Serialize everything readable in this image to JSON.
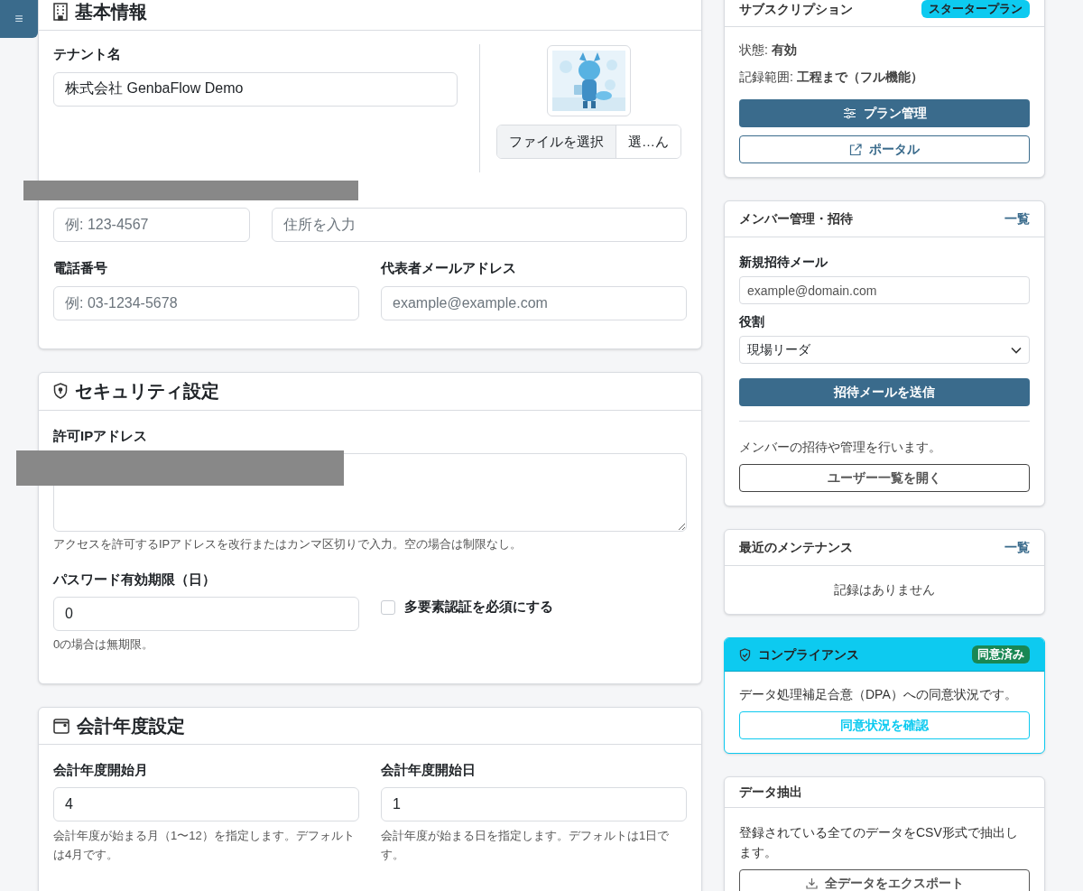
{
  "sidebar_toggle": {
    "label": "≡"
  },
  "basic_info": {
    "title": "基本情報",
    "tenant_name": {
      "label": "テナント名",
      "value": "株式会社 GenbaFlow Demo"
    },
    "file_button": "ファイルを選択",
    "file_name": "選…ん",
    "postal_code": {
      "placeholder": "例: 123-4567"
    },
    "address": {
      "placeholder": "住所を入力"
    },
    "phone": {
      "label": "電話番号",
      "placeholder": "例: 03-1234-5678"
    },
    "email": {
      "label": "代表者メールアドレス",
      "placeholder": "example@example.com"
    }
  },
  "security": {
    "title": "セキュリティ設定",
    "allowed_ip": {
      "label": "許可IPアドレス",
      "help": "アクセスを許可するIPアドレスを改行またはカンマ区切りで入力。空の場合は制限なし。"
    },
    "password_expiry": {
      "label": "パスワード有効期限（日）",
      "value": "0",
      "help": "0の場合は無期限。"
    },
    "mfa": {
      "label": "多要素認証を必須にする",
      "checked": false
    }
  },
  "fiscal_year": {
    "title": "会計年度設定",
    "fields": [
      {
        "label": "会計年度開始月",
        "value": "4",
        "help": "会計年度が始まる月（1〜12）を指定します。デフォルトは4月です。"
      },
      {
        "label": "会計年度開始日",
        "value": "1",
        "help": "会計年度が始まる日を指定します。デフォルトは1日です。"
      }
    ]
  },
  "subscription": {
    "title": "サブスクリプション",
    "plan_badge": "スタータープラン",
    "status": "状態: **有効**",
    "scope": "記録範囲: **工程まで（フル機能）**",
    "buttons": [
      {
        "label": "プラン管理",
        "kind": "primary"
      },
      {
        "label": "ポータル",
        "kind": "outline"
      }
    ]
  },
  "members": {
    "title": "メンバー管理・招待",
    "link": "一覧",
    "email_label": "新規招待メール",
    "email_placeholder": "example@domain.com",
    "role_label": "役割",
    "role_value": "現場リーダ",
    "send_button": "招待メールを送信",
    "note": "メンバーの招待や管理を行います。",
    "open_button": "ユーザー一覧を開く"
  },
  "maintenance": {
    "title": "最近のメンテナンス",
    "link": "一覧",
    "empty": "記録はありません"
  },
  "compliance": {
    "title": "コンプライアンス",
    "badge": "同意済み",
    "text": "データ処理補足合意（DPA）への同意状況です。",
    "button": "同意状況を確認"
  },
  "data_export": {
    "title": "データ抽出",
    "text": "登録されている全てのデータをCSV形式で抽出します。",
    "button": "全データをエクスポート"
  }
}
